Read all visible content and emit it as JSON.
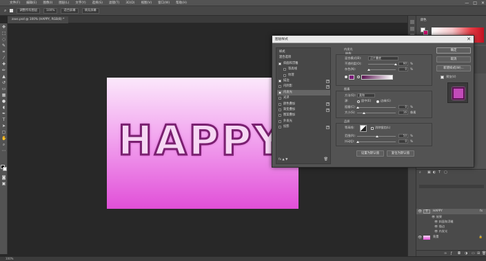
{
  "menubar": {
    "items": [
      "文件(F)",
      "编辑(E)",
      "图像(I)",
      "图层(L)",
      "文字(Y)",
      "选择(S)",
      "滤镜(T)",
      "3D(D)",
      "视图(V)",
      "窗口(W)",
      "帮助(H)"
    ],
    "controls": [
      "—",
      "□",
      "✕"
    ]
  },
  "optionbar": {
    "sample": "调整所有图层",
    "zoom": "100%",
    "fit_screen": "适合屏幕",
    "fill_screen": "填充屏幕"
  },
  "document": {
    "tab_title": "zaxs.psd @ 100% (HAPPY, RGB/8) *",
    "text": "HAPPY",
    "status": "100%"
  },
  "colors": {
    "accent_pink": "#e14fd8",
    "stroke_purple": "#7a2070",
    "bg_swatch": "#d30c70",
    "color_swatch": "#7b1a78"
  },
  "panels": {
    "color_tab": "颜色",
    "adjust_tab": "调整"
  },
  "layers": {
    "rows": [
      {
        "name": "HAPPY",
        "fx": "fx"
      },
      {
        "name": "效果"
      },
      {
        "name": "斜面和浮雕"
      },
      {
        "name": "描边"
      },
      {
        "name": "内发光"
      },
      {
        "name": "背景"
      }
    ]
  },
  "dialog": {
    "title": "图层样式",
    "close": "✕",
    "styles": [
      {
        "label": "样式",
        "checked": null,
        "plus": false,
        "header": true
      },
      {
        "label": "混合选项",
        "checked": null,
        "plus": false,
        "header": true
      },
      {
        "label": "斜面和浮雕",
        "checked": true,
        "plus": false
      },
      {
        "label": "等高线",
        "checked": false,
        "plus": false
      },
      {
        "label": "纹理",
        "checked": false,
        "plus": false
      },
      {
        "label": "描边",
        "checked": true,
        "plus": true
      },
      {
        "label": "内阴影",
        "checked": false,
        "plus": true
      },
      {
        "label": "内发光",
        "checked": true,
        "plus": false,
        "selected": true
      },
      {
        "label": "光泽",
        "checked": false,
        "plus": false
      },
      {
        "label": "颜色叠加",
        "checked": false,
        "plus": true
      },
      {
        "label": "渐变叠加",
        "checked": false,
        "plus": true
      },
      {
        "label": "图案叠加",
        "checked": false,
        "plus": false
      },
      {
        "label": "外发光",
        "checked": false,
        "plus": false
      },
      {
        "label": "投影",
        "checked": false,
        "plus": true
      }
    ],
    "fx_footer": "fx ▲ ▼",
    "inner_glow": {
      "section": "内发光",
      "structure": "结构",
      "blend_mode_label": "混合模式(B):",
      "blend_mode_value": "正片叠底",
      "opacity_label": "不透明度(O):",
      "opacity_value": "90",
      "noise_label": "杂色(N):",
      "noise_value": "0",
      "percent": "%",
      "elements": "图素",
      "technique_label": "方法(Q):",
      "technique_value": "柔和",
      "source_label": "源:",
      "source_center": "居中(E)",
      "source_edge": "边缘(G)",
      "choke_label": "阻塞(C):",
      "choke_value": "0",
      "size_label": "大小(S):",
      "size_value": "16",
      "px": "像素",
      "quality": "品质",
      "contour_label": "等高线:",
      "antialias": "消除锯齿(L)",
      "range_label": "范围(R):",
      "range_value": "50",
      "jitter_label": "抖动(J):",
      "jitter_value": "0",
      "set_default": "设置为默认值",
      "reset_default": "复位为默认值"
    },
    "buttons": {
      "ok": "确定",
      "cancel": "取消",
      "new_style": "新建样式(W)...",
      "preview": "预览(V)"
    }
  }
}
